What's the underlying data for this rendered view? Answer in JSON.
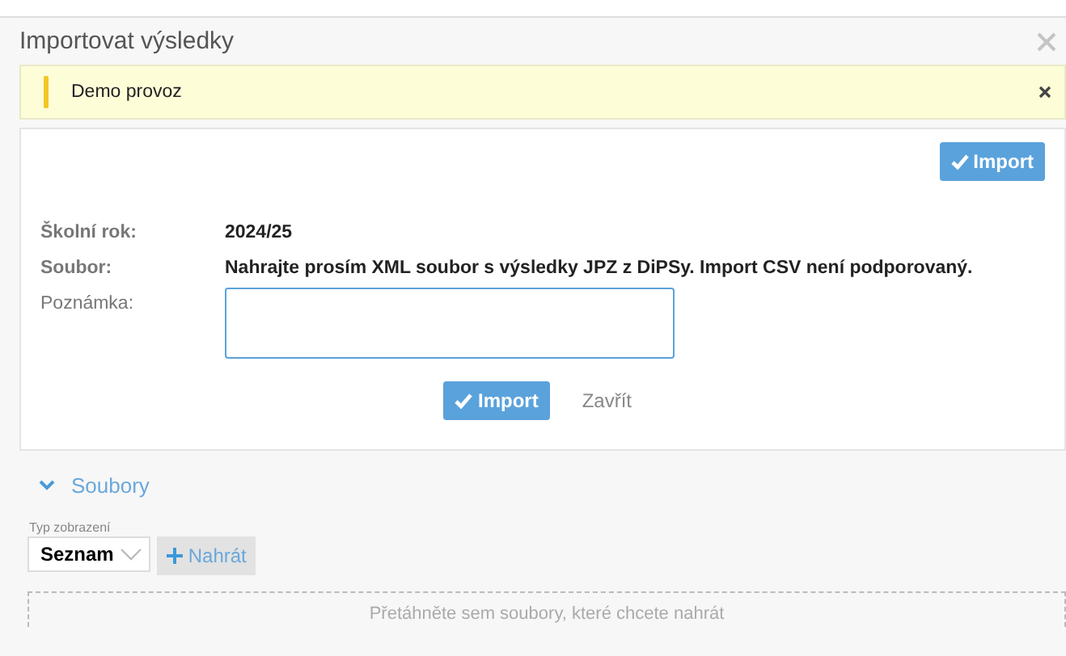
{
  "window": {
    "title": "Importovat výsledky"
  },
  "alert": {
    "text": "Demo provoz"
  },
  "form": {
    "top_button": "Import",
    "fields": [
      {
        "kind": "text",
        "label": "Školní rok:",
        "value": "2024/25"
      },
      {
        "kind": "text",
        "label": "Soubor:",
        "value": "Nahrajte prosím XML soubor s výsledky JPZ z DiPSy. Import CSV není podporovaný."
      },
      {
        "kind": "textarea",
        "label": "Poznámka:"
      }
    ],
    "buttons": [
      {
        "kind": "primary",
        "label": "Import"
      },
      {
        "kind": "link",
        "label": "Zavřít"
      }
    ]
  },
  "files": {
    "title": "Soubory",
    "expanded": true,
    "view_label": "Typ zobrazení",
    "view_value": "Seznam",
    "upload_button": "Nahrát",
    "drop_text": "Přetáhněte sem soubory, které chcete nahrát"
  }
}
